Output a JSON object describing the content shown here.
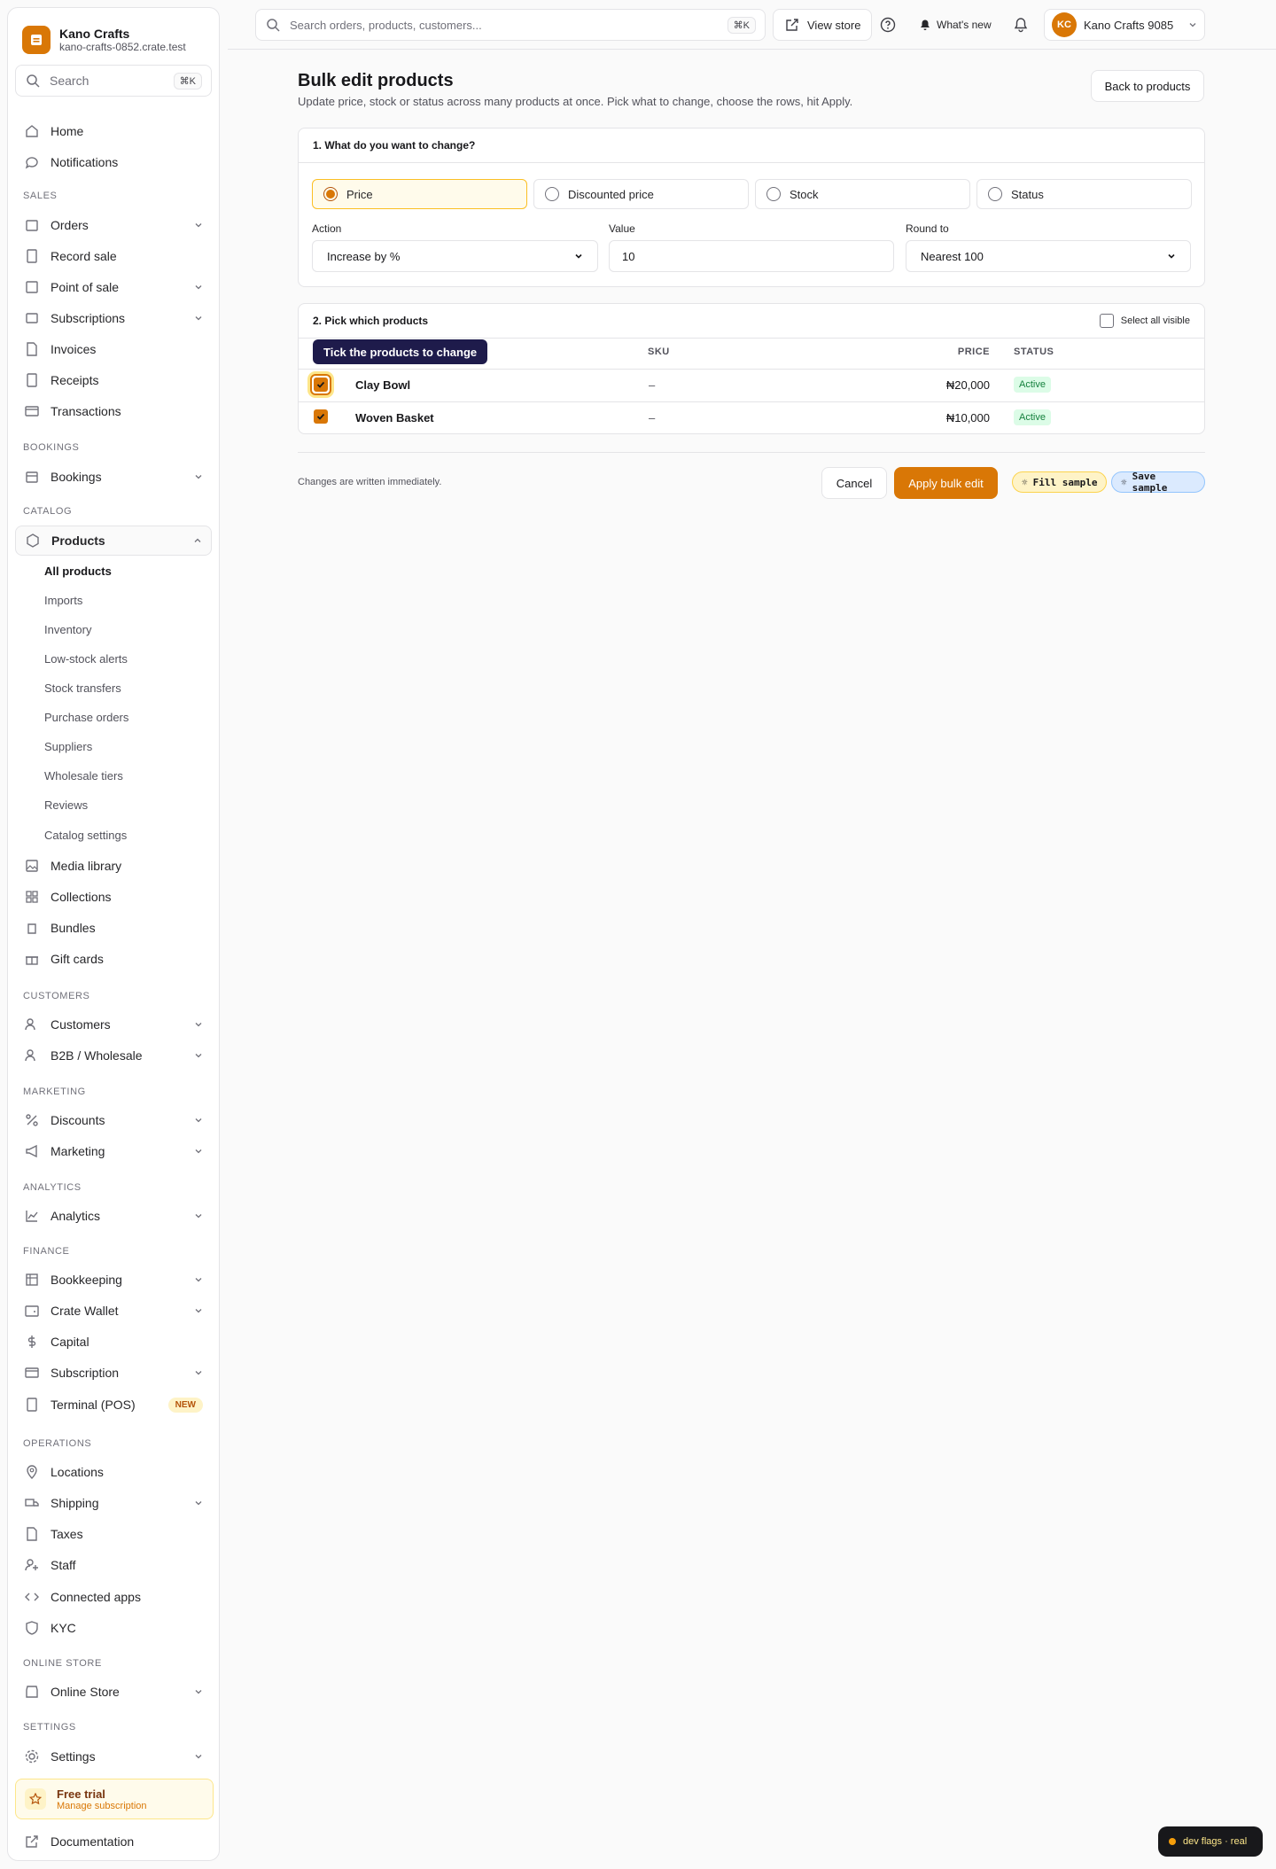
{
  "brand": {
    "name": "Kano Crafts",
    "domain": "kano-crafts-0852.crate.test"
  },
  "sidebar": {
    "search_placeholder": "Search",
    "search_kbd": "⌘K",
    "top": [
      {
        "label": "Home"
      },
      {
        "label": "Notifications"
      }
    ],
    "sections": {
      "sales": "SALES",
      "bookings": "BOOKINGS",
      "catalog": "CATALOG",
      "customers": "CUSTOMERS",
      "marketing": "MARKETING",
      "analytics": "ANALYTICS",
      "finance": "FINANCE",
      "operations": "OPERATIONS",
      "online_store": "ONLINE STORE",
      "settings": "SETTINGS"
    },
    "sales": [
      "Orders",
      "Record sale",
      "Point of sale",
      "Subscriptions",
      "Invoices",
      "Receipts",
      "Transactions"
    ],
    "bookings": [
      "Bookings"
    ],
    "products": "Products",
    "catalog_sub": [
      "All products",
      "Imports",
      "Inventory",
      "Low-stock alerts",
      "Stock transfers",
      "Purchase orders",
      "Suppliers",
      "Wholesale tiers",
      "Reviews",
      "Catalog settings"
    ],
    "catalog_more": [
      "Media library",
      "Collections",
      "Bundles",
      "Gift cards"
    ],
    "customers": [
      "Customers",
      "B2B / Wholesale"
    ],
    "marketing": [
      "Discounts",
      "Marketing"
    ],
    "analytics": [
      "Analytics"
    ],
    "finance": [
      "Bookkeeping",
      "Crate Wallet",
      "Capital",
      "Subscription",
      "Terminal (POS)"
    ],
    "new_badge": "NEW",
    "operations": [
      "Locations",
      "Shipping",
      "Taxes",
      "Staff",
      "Connected apps",
      "KYC"
    ],
    "online_store": [
      "Online Store"
    ],
    "settings": [
      "Settings"
    ],
    "trial": {
      "title": "Free trial",
      "sub": "Manage subscription"
    },
    "documentation": "Documentation"
  },
  "topbar": {
    "search_placeholder": "Search orders, products, customers...",
    "search_kbd": "⌘K",
    "view_store": "View store",
    "whats_new": "What's new",
    "account": "Kano Crafts 9085",
    "initials": "KC"
  },
  "page": {
    "title": "Bulk edit products",
    "subtitle": "Update price, stock or status across many products at once. Pick what to change, choose the rows, hit Apply.",
    "back": "Back to products"
  },
  "step1": {
    "title": "1. What do you want to change?",
    "options": [
      "Price",
      "Discounted price",
      "Stock",
      "Status"
    ],
    "selected": "Price",
    "action_label": "Action",
    "action_value": "Increase by %",
    "value_label": "Value",
    "value": "10",
    "round_label": "Round to",
    "round_value": "Nearest 100"
  },
  "step2": {
    "title": "2. Pick which products",
    "select_all": "Select all visible",
    "tooltip": "Tick the products to change",
    "columns": {
      "sku": "SKU",
      "price": "PRICE",
      "status": "STATUS"
    },
    "rows": [
      {
        "name": "Clay Bowl",
        "sku": "–",
        "price": "₦20,000",
        "status": "Active",
        "checked": true
      },
      {
        "name": "Woven Basket",
        "sku": "–",
        "price": "₦10,000",
        "status": "Active",
        "checked": true
      }
    ]
  },
  "footer": {
    "note": "Changes are written immediately.",
    "cancel": "Cancel",
    "apply": "Apply bulk edit",
    "fill": "Fill sample",
    "save": "Save sample"
  },
  "dev": "dev flags · real",
  "colors": {
    "accent": "#d97706",
    "active_badge": "#15803d"
  }
}
